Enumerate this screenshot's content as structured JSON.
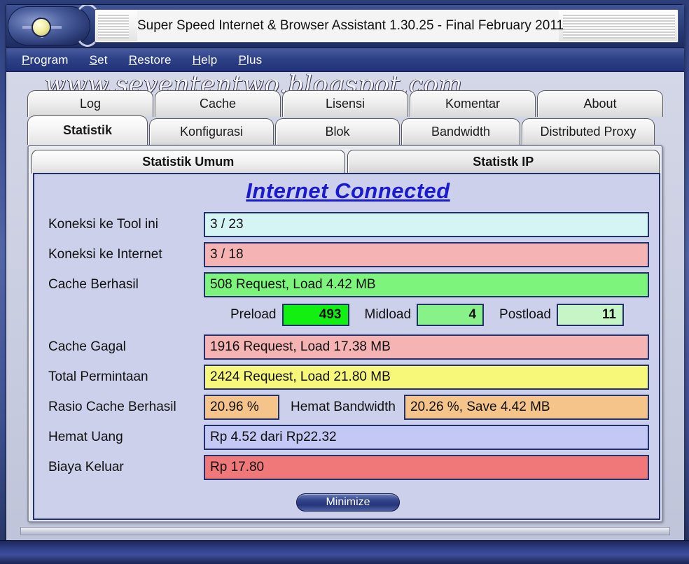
{
  "window": {
    "title": "Super Speed Internet & Browser Assistant 1.30.25 - Final February 2011",
    "icon": "target-orb-icon"
  },
  "menu": {
    "items": [
      {
        "accel": "P",
        "rest": "rogram"
      },
      {
        "accel": "S",
        "rest": "et"
      },
      {
        "accel": "R",
        "rest": "estore"
      },
      {
        "accel": "H",
        "rest": "elp"
      },
      {
        "accel": "P",
        "rest": "lus"
      }
    ]
  },
  "watermark": "www.sevententwo.blogspot.com",
  "tabs_top": [
    {
      "label": "Log"
    },
    {
      "label": "Cache"
    },
    {
      "label": "Lisensi"
    },
    {
      "label": "Komentar"
    },
    {
      "label": "About"
    }
  ],
  "tabs_bottom": [
    {
      "label": "Statistik",
      "active": true
    },
    {
      "label": "Konfigurasi"
    },
    {
      "label": "Blok"
    },
    {
      "label": "Bandwidth"
    },
    {
      "label": "Distributed Proxy"
    }
  ],
  "inner_tabs": [
    {
      "label": "Statistik Umum",
      "active": true
    },
    {
      "label": "Statistk IP"
    }
  ],
  "status": {
    "text": "Internet Connected",
    "color": "#1a1ad0"
  },
  "rows": [
    {
      "label": "Koneksi ke Tool ini",
      "value": "3 / 23",
      "color": "#d5f5f5"
    },
    {
      "label": "Koneksi ke Internet",
      "value": "3 / 18",
      "color": "#f5b3b3"
    },
    {
      "label": "Cache Berhasil",
      "value": "508 Request, Load 4.42 MB",
      "color": "#7df57d"
    }
  ],
  "loads": [
    {
      "label": "Preload",
      "value": "493",
      "color": "#12f012"
    },
    {
      "label": "Midload",
      "value": "4",
      "color": "#88f288"
    },
    {
      "label": "Postload",
      "value": "11",
      "color": "#c6f5c6"
    }
  ],
  "rows2": [
    {
      "label": "Cache Gagal",
      "value": "1916 Request, Load 17.38 MB",
      "color": "#f5b3b3"
    },
    {
      "label": "Total Permintaan",
      "value": "2424 Request, Load 21.80 MB",
      "color": "#f7f77a"
    }
  ],
  "ratio": {
    "label": "Rasio Cache Berhasil",
    "value": "20.96 %",
    "color": "#f5c48a",
    "bandwidth_label": "Hemat Bandwidth",
    "bandwidth_value": "20.26 %, Save 4.42 MB",
    "bandwidth_color": "#f5c48a"
  },
  "rows3": [
    {
      "label": "Hemat Uang",
      "value": "Rp 4.52 dari Rp22.32",
      "color": "#c3c8f5"
    },
    {
      "label": "Biaya Keluar",
      "value": "Rp 17.80",
      "color": "#f07878"
    }
  ],
  "minimize": {
    "label": "Minimize"
  }
}
